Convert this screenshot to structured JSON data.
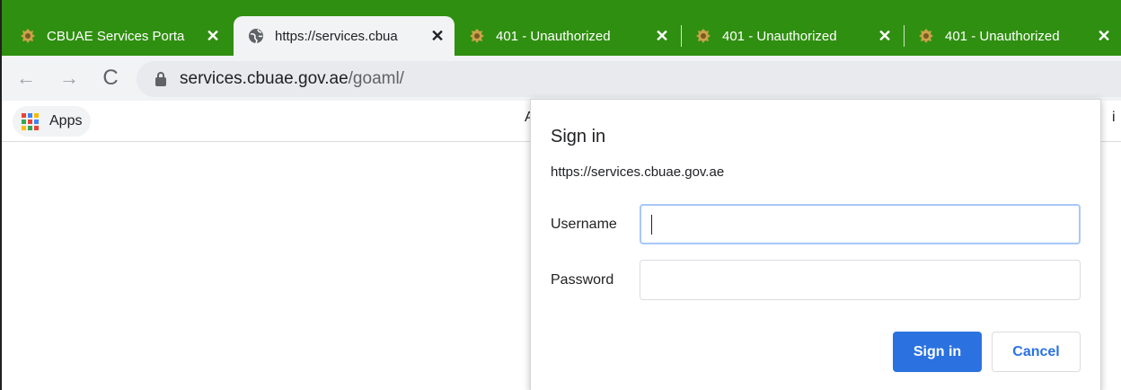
{
  "tabs": [
    {
      "label": "CBUAE Services Porta",
      "icon": "emblem-icon",
      "close": "✕"
    },
    {
      "label": "https://services.cbua",
      "icon": "globe-icon",
      "close": "✕"
    },
    {
      "label": "401 - Unauthorized",
      "icon": "emblem-icon",
      "close": "✕"
    },
    {
      "label": "401 - Unauthorized",
      "icon": "emblem-icon",
      "close": "✕"
    },
    {
      "label": "401 - Unauthorized",
      "icon": "emblem-icon",
      "close": "✕"
    }
  ],
  "toolbar": {
    "back": "←",
    "forward": "→",
    "reload": "C"
  },
  "address": {
    "host": "services.cbuae.gov.ae",
    "path": "/goaml/"
  },
  "bookmarks": {
    "apps_label": "Apps",
    "fragment_left": "A",
    "fragment_right": "i"
  },
  "dialog": {
    "title": "Sign in",
    "origin": "https://services.cbuae.gov.ae",
    "username_label": "Username",
    "username_value": "",
    "password_label": "Password",
    "password_value": "",
    "signin_label": "Sign in",
    "cancel_label": "Cancel"
  },
  "colors": {
    "tabstrip": "#2f8f10",
    "primary_button": "#2b72e0"
  }
}
